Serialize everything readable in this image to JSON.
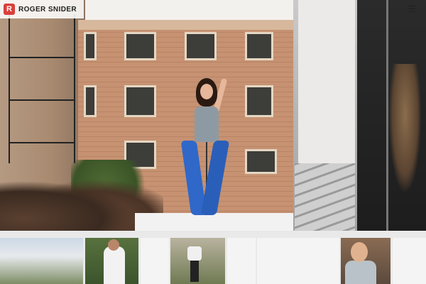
{
  "header": {
    "brand": "ROGER SNIDER",
    "logo_letter": "R",
    "menu_icon": "☰"
  },
  "hero": {
    "image": "concert-performer-hero-photo"
  },
  "thumbnails": [
    {
      "name": "thumb-street-trees"
    },
    {
      "name": "thumb-man-white-shirt"
    },
    {
      "name": "thumb-blank-1"
    },
    {
      "name": "thumb-dancer"
    },
    {
      "name": "thumb-blank-2"
    },
    {
      "name": "thumb-blank-3"
    },
    {
      "name": "thumb-portrait-man"
    },
    {
      "name": "thumb-blank-4"
    }
  ],
  "colors": {
    "brand_red": "#d9403a",
    "performer_pants": "#2f68c9"
  }
}
